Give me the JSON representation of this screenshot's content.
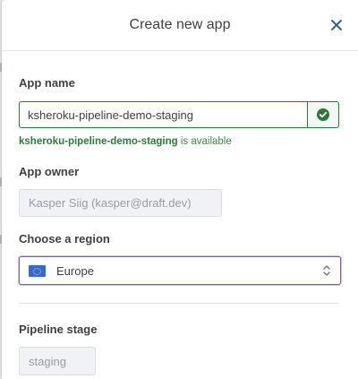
{
  "modal": {
    "title": "Create new app",
    "close_icon": "close-icon"
  },
  "app_name": {
    "label": "App name",
    "value": "ksheroku-pipeline-demo-staging",
    "status_icon": "check-circle-icon",
    "status_color": "#2a7c36",
    "availability_name": "ksheroku-pipeline-demo-staging",
    "availability_suffix": "is available"
  },
  "app_owner": {
    "label": "App owner",
    "value": "Kasper Siig (kasper@draft.dev)"
  },
  "region": {
    "label": "Choose a region",
    "selected": "Europe",
    "flag_icon": "eu-flag-icon",
    "chevron_icon": "chevron-updown-icon",
    "focus_color": "#7b62a8"
  },
  "pipeline": {
    "label": "Pipeline stage",
    "value": "staging"
  }
}
